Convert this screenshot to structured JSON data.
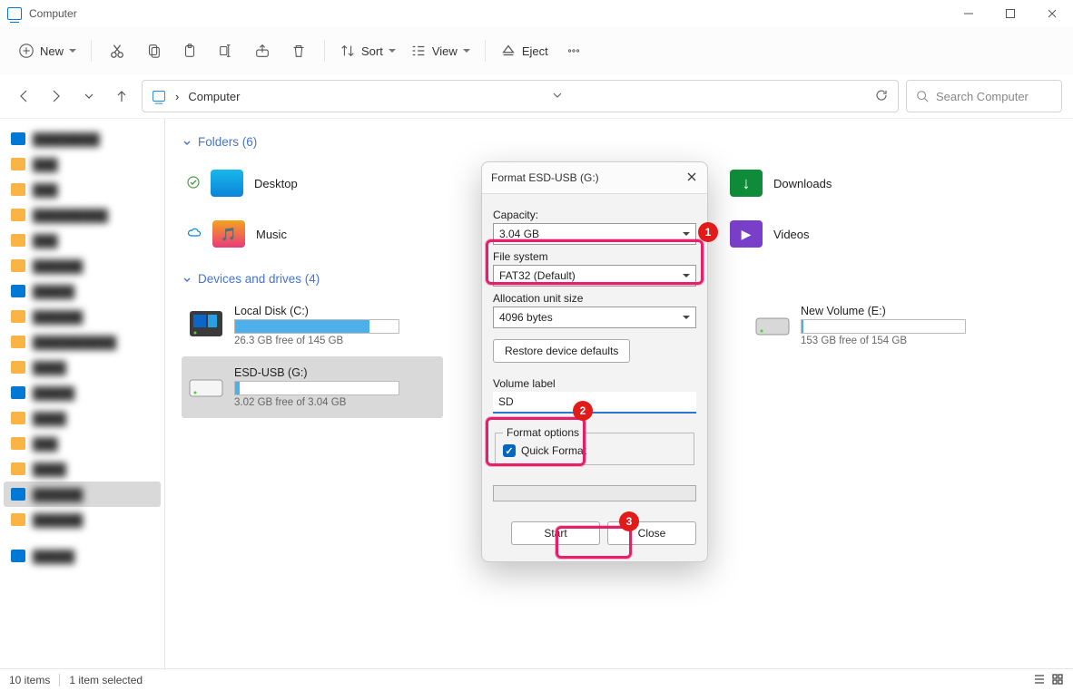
{
  "titlebar": {
    "title": "Computer"
  },
  "toolbar": {
    "new": "New",
    "sort": "Sort",
    "view": "View",
    "eject": "Eject"
  },
  "nav": {
    "crumb_root": "Computer",
    "search_placeholder": "Search Computer"
  },
  "sections": {
    "folders_header": "Folders (6)",
    "drives_header": "Devices and drives (4)"
  },
  "folders": {
    "desktop": "Desktop",
    "music": "Music",
    "downloads": "Downloads",
    "videos": "Videos"
  },
  "drives": {
    "local": {
      "name": "Local Disk (C:)",
      "sub": "26.3 GB free of 145 GB",
      "fill_pct": 82
    },
    "esd": {
      "name": "ESD-USB (G:)",
      "sub": "3.02 GB free of 3.04 GB",
      "fill_pct": 3
    },
    "newvol": {
      "name": "New Volume (E:)",
      "sub": "153 GB free of 154 GB",
      "fill_pct": 1
    }
  },
  "dialog": {
    "title": "Format ESD-USB (G:)",
    "labels": {
      "capacity": "Capacity:",
      "filesystem": "File system",
      "alloc": "Allocation unit size",
      "restore": "Restore device defaults",
      "volume": "Volume label",
      "format_options": "Format options",
      "quick": "Quick Format"
    },
    "values": {
      "capacity": "3.04 GB",
      "filesystem": "FAT32 (Default)",
      "alloc": "4096 bytes",
      "volume": "SD"
    },
    "buttons": {
      "start": "Start",
      "close": "Close"
    }
  },
  "annotations": {
    "b1": "1",
    "b2": "2",
    "b3": "3"
  },
  "status": {
    "items": "10 items",
    "selected": "1 item selected"
  }
}
